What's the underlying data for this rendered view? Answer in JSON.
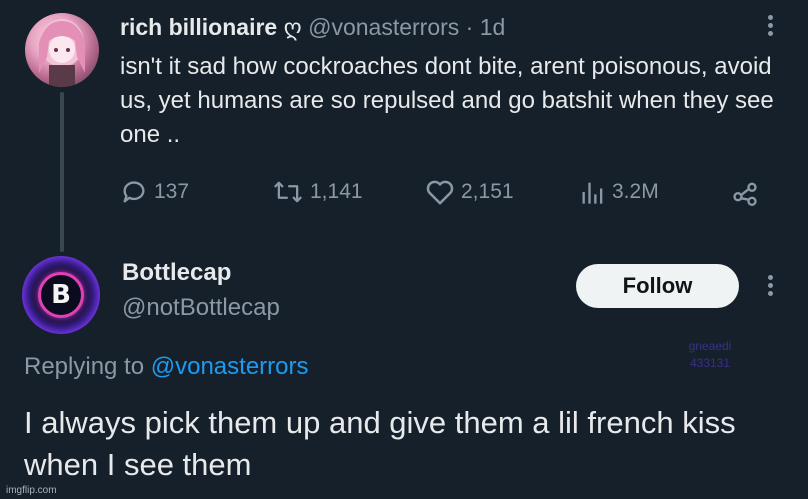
{
  "original_tweet": {
    "display_name": "rich billionaire",
    "name_emoji": "ღ",
    "handle": "@vonasterrors",
    "separator": "·",
    "age": "1d",
    "text": "isn't it sad how cockroaches dont bite, arent poisonous, avoid us, yet humans  are so repulsed and go batshit when they see one ..",
    "stats": {
      "replies": "137",
      "retweets": "1,141",
      "likes": "2,151",
      "views": "3.2M"
    },
    "icons": {
      "reply": "reply-icon",
      "retweet": "retweet-icon",
      "like": "heart-icon",
      "views": "views-icon",
      "share": "share-icon",
      "more": "more-icon"
    }
  },
  "reply_tweet": {
    "display_name": "Bottlecap",
    "handle": "@notBottlecap",
    "avatar_letter": "B",
    "follow_label": "Follow",
    "replying_prefix": "Replying to",
    "replying_to": "@vonasterrors",
    "text": "I always pick them up and give them a lil french kiss when I see them",
    "watermark_line1": "gneaedi",
    "watermark_line2": "433131"
  },
  "footer": {
    "imgflip": "imgflip.com"
  },
  "colors": {
    "background": "#15202b",
    "text": "#e7e9ea",
    "muted": "#8b98a5",
    "link": "#1d9bf0",
    "follow_bg": "#eff3f4"
  }
}
